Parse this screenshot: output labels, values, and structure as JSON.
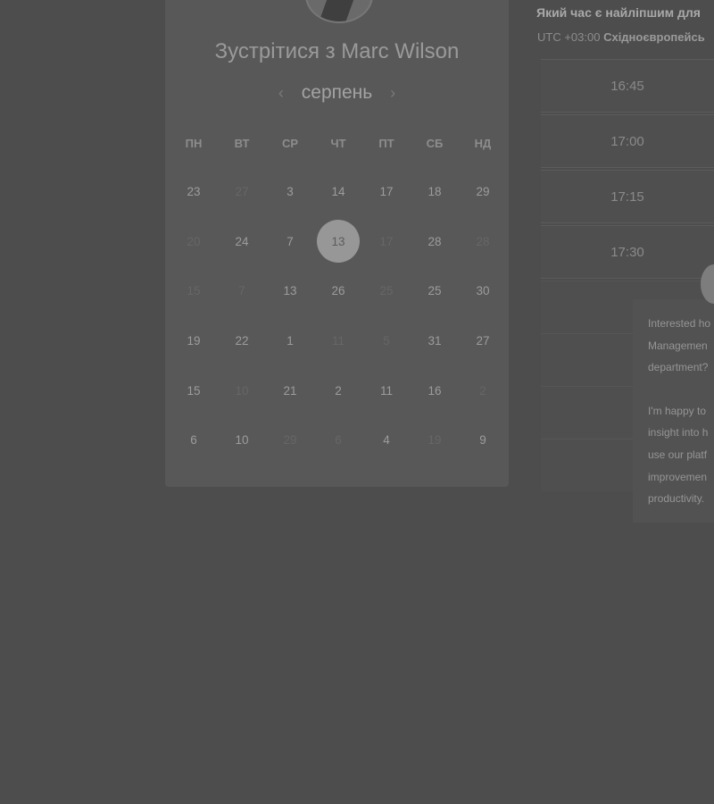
{
  "header": {
    "title": "Зустрітися з Marc Wilson"
  },
  "calendar": {
    "month": "серпень",
    "prev_icon": "chevron-left-icon",
    "next_icon": "chevron-right-icon",
    "weekdays": [
      "ПН",
      "ВТ",
      "СР",
      "ЧТ",
      "ПТ",
      "СБ",
      "НД"
    ],
    "weeks": [
      [
        {
          "d": "23",
          "dim": false
        },
        {
          "d": "27",
          "dim": true
        },
        {
          "d": "3",
          "dim": false
        },
        {
          "d": "14",
          "dim": false
        },
        {
          "d": "17",
          "dim": false
        },
        {
          "d": "18",
          "dim": false
        },
        {
          "d": "29",
          "dim": false
        }
      ],
      [
        {
          "d": "20",
          "dim": true
        },
        {
          "d": "24",
          "dim": false
        },
        {
          "d": "7",
          "dim": false
        },
        {
          "d": "13",
          "dim": false,
          "selected": true
        },
        {
          "d": "17",
          "dim": true
        },
        {
          "d": "28",
          "dim": false
        },
        {
          "d": "28",
          "dim": true
        }
      ],
      [
        {
          "d": "15",
          "dim": true
        },
        {
          "d": "7",
          "dim": true
        },
        {
          "d": "13",
          "dim": false
        },
        {
          "d": "26",
          "dim": false
        },
        {
          "d": "25",
          "dim": true
        },
        {
          "d": "25",
          "dim": false
        },
        {
          "d": "30",
          "dim": false
        }
      ],
      [
        {
          "d": "19",
          "dim": false
        },
        {
          "d": "22",
          "dim": false
        },
        {
          "d": "1",
          "dim": false
        },
        {
          "d": "11",
          "dim": true
        },
        {
          "d": "5",
          "dim": true
        },
        {
          "d": "31",
          "dim": false
        },
        {
          "d": "27",
          "dim": false
        }
      ],
      [
        {
          "d": "15",
          "dim": false
        },
        {
          "d": "10",
          "dim": true
        },
        {
          "d": "21",
          "dim": false
        },
        {
          "d": "2",
          "dim": false
        },
        {
          "d": "11",
          "dim": false
        },
        {
          "d": "16",
          "dim": false
        },
        {
          "d": "2",
          "dim": true
        }
      ],
      [
        {
          "d": "6",
          "dim": false
        },
        {
          "d": "10",
          "dim": false
        },
        {
          "d": "29",
          "dim": true
        },
        {
          "d": "6",
          "dim": true
        },
        {
          "d": "4",
          "dim": false
        },
        {
          "d": "19",
          "dim": true
        },
        {
          "d": "9",
          "dim": false
        }
      ]
    ]
  },
  "times": {
    "heading": "Який час є найліпшим для",
    "timezone_prefix": "UTC +03:00 ",
    "timezone_name": "Східноєвропейсь",
    "slots": [
      "16:45",
      "17:00",
      "17:15",
      "17:30"
    ]
  },
  "chat": {
    "lines_1": [
      "Interested ho",
      "Managemen",
      "department?"
    ],
    "lines_2": [
      "I'm happy to",
      "insight into h",
      "use our platf",
      "improvemen",
      "productivity."
    ]
  }
}
